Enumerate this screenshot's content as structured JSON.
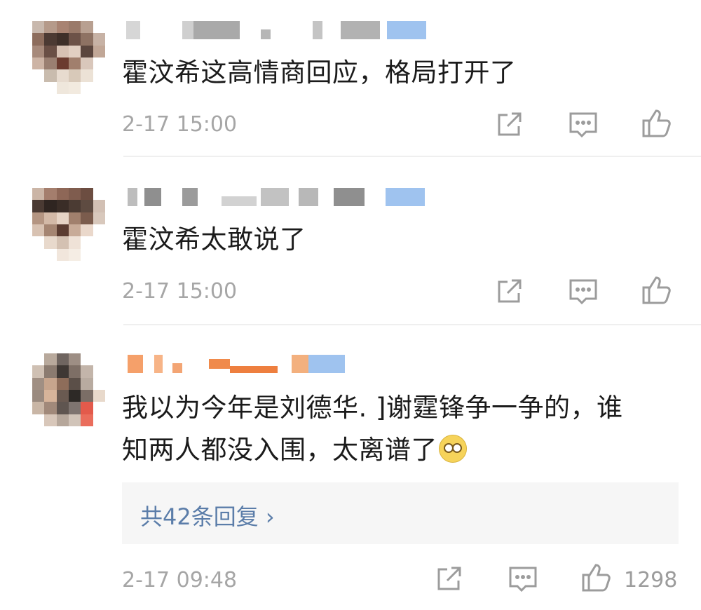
{
  "comments": [
    {
      "text": "霍汶希这高情商回应，格局打开了",
      "time": "2-17 15:00",
      "likes": ""
    },
    {
      "text": "霍汶希太敢说了",
      "time": "2-17 15:00",
      "likes": ""
    },
    {
      "text_line1": "我以为今年是刘德华.  ]谢霆锋争一争的，谁",
      "text_line2": "知两人都没入围，太离谱了",
      "time": "2-17 09:48",
      "likes": "1298",
      "replies_label": "共42条回复 ›"
    }
  ],
  "icons": [
    "share-icon",
    "comment-icon",
    "like-icon"
  ],
  "colors": {
    "text": "#1b1b1b",
    "meta": "#a6a6a6",
    "link": "#5b7da9",
    "reply_bg": "#f6f6f6"
  }
}
